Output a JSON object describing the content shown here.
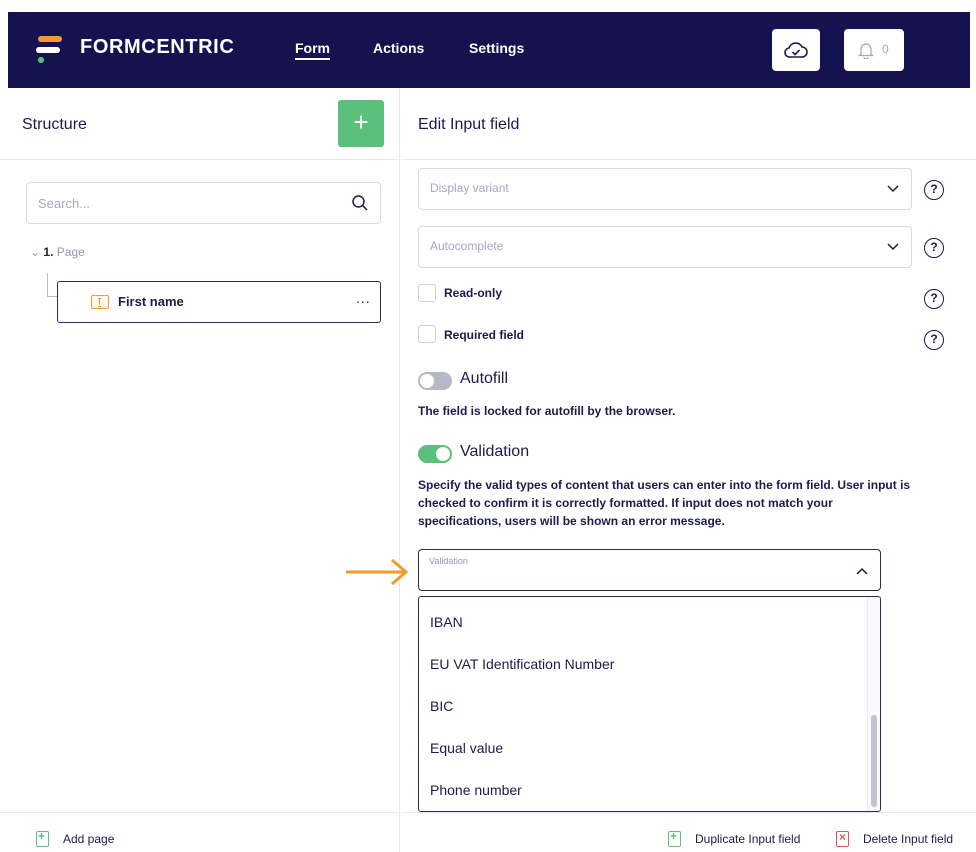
{
  "header": {
    "brand": "FORMCENTRIC",
    "nav": [
      "Form",
      "Actions",
      "Settings"
    ],
    "notification_count": "0",
    "cloud_icon": "cloud-check-icon",
    "bell_icon": "bell-icon",
    "colors": {
      "nav_bg": "#15134f",
      "accent": "#5cc07d",
      "brand_orange": "#f39a2e",
      "danger": "#e0554e"
    }
  },
  "structure": {
    "title": "Structure",
    "add_label": "+",
    "search_placeholder": "Search...",
    "page_number": "1.",
    "page_label": "Page",
    "item_label": "First name",
    "item_more": "...",
    "add_page": "Add page"
  },
  "editor": {
    "title": "Edit Input field",
    "display_variant": "Display variant",
    "autocomplete": "Autocomplete",
    "read_only": "Read-only",
    "required": "Required field",
    "autofill_label": "Autofill",
    "autofill_on": false,
    "autofill_desc": "The field is locked for autofill by the browser.",
    "validation_label": "Validation",
    "validation_on": true,
    "validation_desc": "Specify the valid types of content that users can enter into the form field. User input is checked to confirm it is correctly formatted. If input does not match your specifications, users will be shown an error message.",
    "validation_select_label": "Validation",
    "validation_options": [
      "IBAN",
      "EU VAT Identification Number",
      "BIC",
      "Equal value",
      "Phone number"
    ],
    "duplicate": "Duplicate Input field",
    "delete": "Delete Input field",
    "help_glyph": "?"
  }
}
